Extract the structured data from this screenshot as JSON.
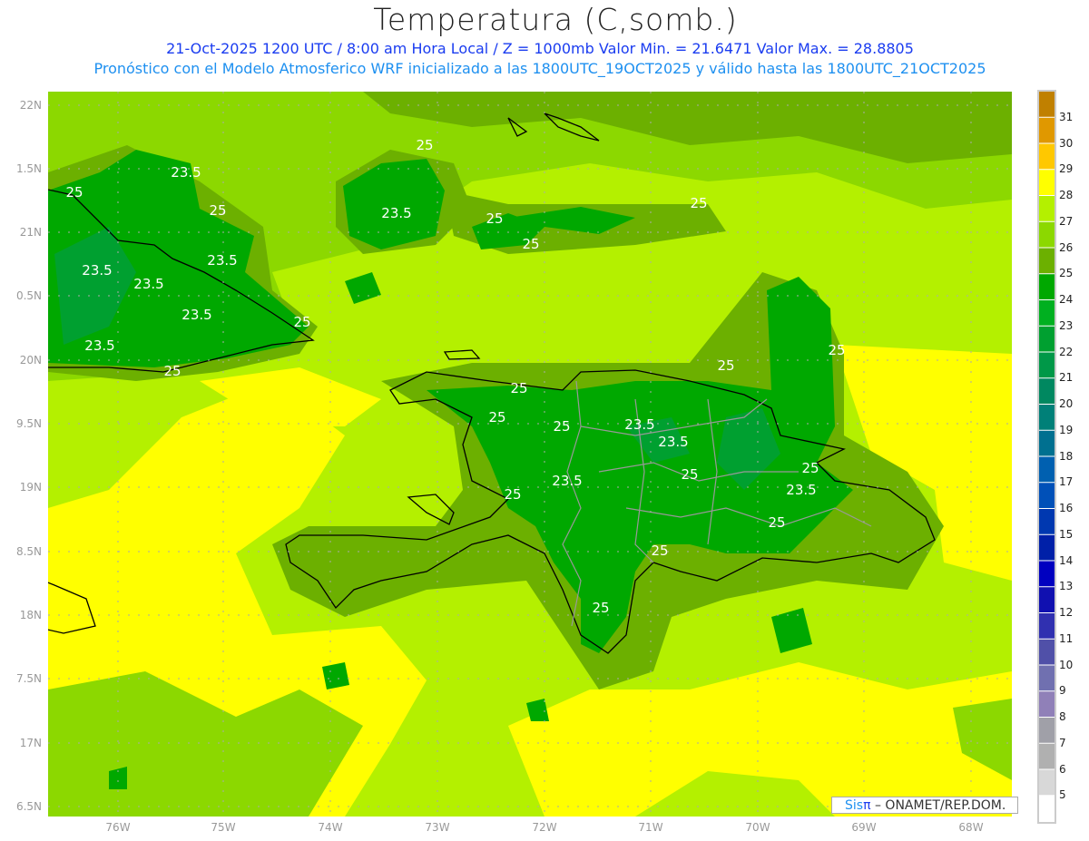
{
  "header": {
    "title": "Temperatura (C,somb.)",
    "line1": "21-Oct-2025  1200 UTC / 8:00 am Hora Local / Z = 1000mb    Valor Min. = 21.6471   Valor Max. = 28.8805",
    "line2": "Pronóstico con el Modelo Atmosferico WRF inicializado a las 1800UTC_19OCT2025 y válido hasta las  1800UTC_21OCT2025"
  },
  "axes": {
    "lat_labels": [
      "22N",
      "1.5N",
      "21N",
      "0.5N",
      "20N",
      "9.5N",
      "19N",
      "8.5N",
      "18N",
      "7.5N",
      "17N",
      "6.5N"
    ],
    "lon_labels": [
      "76W",
      "75W",
      "74W",
      "73W",
      "72W",
      "71W",
      "70W",
      "69W",
      "68W"
    ]
  },
  "colorbar": {
    "labels": [
      "31",
      "30",
      "29",
      "28",
      "27",
      "26",
      "25",
      "24",
      "23",
      "22",
      "21",
      "20",
      "19",
      "18",
      "17",
      "16",
      "15",
      "14",
      "13",
      "12",
      "11",
      "10",
      "9",
      "8",
      "7",
      "6",
      "5"
    ],
    "colors": [
      "#c08000",
      "#e09800",
      "#ffc800",
      "#ffff00",
      "#b4f000",
      "#8cd800",
      "#6cb000",
      "#00a800",
      "#00b020",
      "#00a030",
      "#009848",
      "#008860",
      "#008078",
      "#007090",
      "#0060b0",
      "#0050b8",
      "#0038b0",
      "#0020a8",
      "#0000c0",
      "#1010b0",
      "#3030b0",
      "#5050a8",
      "#7070b0",
      "#9080b8",
      "#a0a0a8",
      "#b0b0b0",
      "#d8d8d8",
      "#ffffff"
    ]
  },
  "contour_labels": [
    "25",
    "23.5",
    "25",
    "25",
    "23.5",
    "25",
    "25",
    "25",
    "23.5",
    "23.5",
    "23.5",
    "23.5",
    "25",
    "23.5",
    "25",
    "25",
    "25",
    "25",
    "25",
    "25",
    "23.5",
    "23.5",
    "25",
    "25",
    "23.5",
    "23.5",
    "25",
    "25",
    "25",
    "25"
  ],
  "credit": {
    "sis": "Sis",
    "pi": "π",
    "rest": "– ONAMET/REP.DOM."
  }
}
